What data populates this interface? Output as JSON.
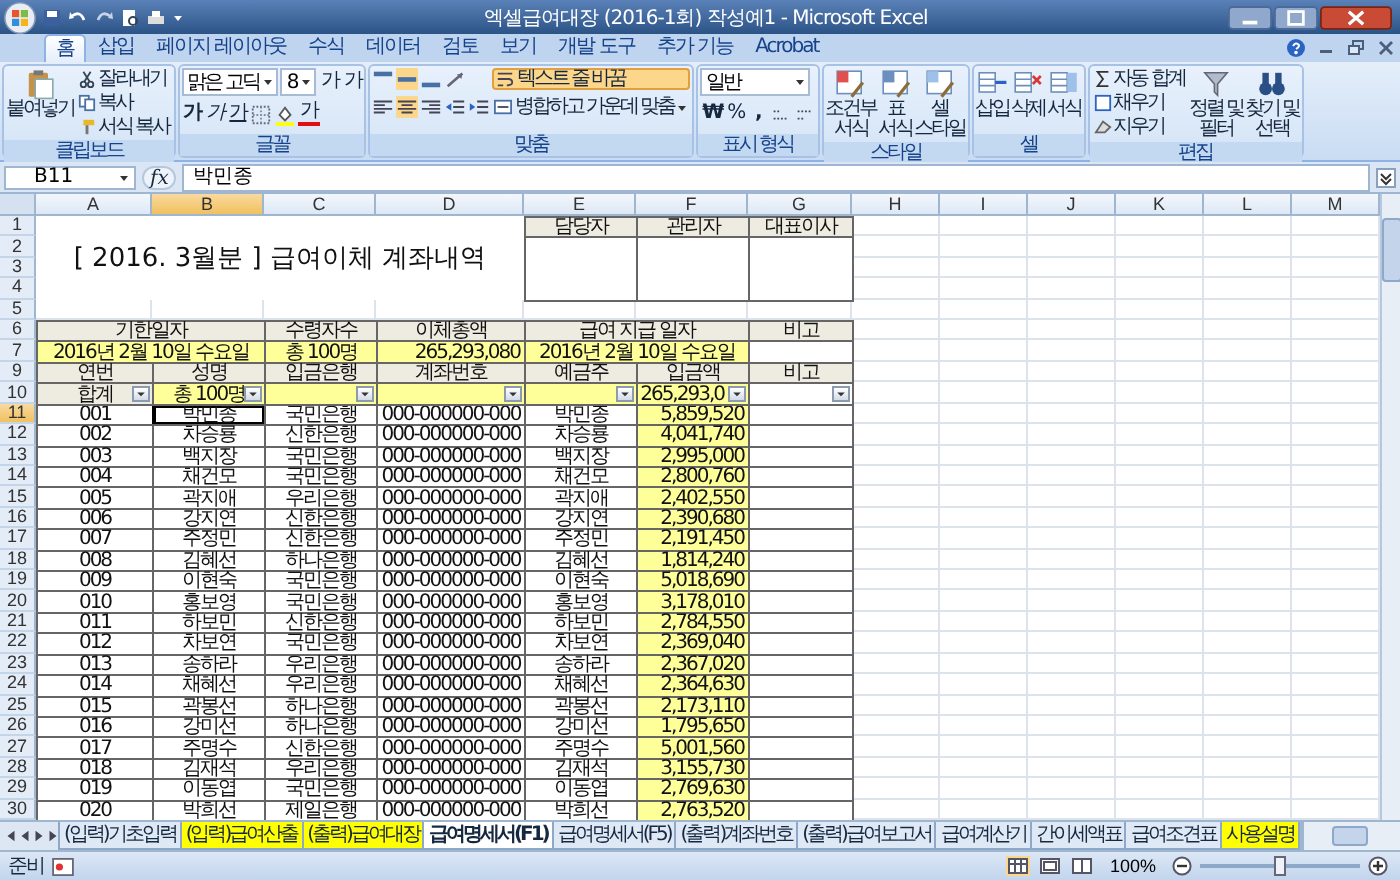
{
  "window": {
    "title": "엑셀급여대장 (2016-1회) 작성예1 - Microsoft Excel"
  },
  "ribbon_tabs": [
    {
      "label": "홈",
      "selected": true
    },
    {
      "label": "삽입",
      "selected": false
    },
    {
      "label": "페이지 레이아웃",
      "selected": false
    },
    {
      "label": "수식",
      "selected": false
    },
    {
      "label": "데이터",
      "selected": false
    },
    {
      "label": "검토",
      "selected": false
    },
    {
      "label": "보기",
      "selected": false
    },
    {
      "label": "개발 도구",
      "selected": false
    },
    {
      "label": "추가 기능",
      "selected": false
    },
    {
      "label": "Acrobat",
      "selected": false
    }
  ],
  "ribbon": {
    "clipboard": {
      "paste": "붙여넣기",
      "cut": "잘라내기",
      "copy": "복사",
      "format_painter": "서식 복사",
      "label": "클립보드"
    },
    "font": {
      "name": "맑은 고딕",
      "size": "8",
      "grow": "가",
      "shrink": "가",
      "bold": "가",
      "italic": "가",
      "underline": "가",
      "font_color": "가",
      "label": "글꼴"
    },
    "alignment": {
      "vertical": [
        {
          "selected": false
        },
        {
          "selected": true
        },
        {
          "selected": false
        }
      ],
      "horizontal": [
        {
          "selected": false
        },
        {
          "selected": true
        },
        {
          "selected": false
        }
      ],
      "wrap_text": {
        "label": "텍스트 줄 바꿈",
        "on": true
      },
      "merge": "병합하고 가운데 맞춤",
      "label": "맞춤"
    },
    "number": {
      "format": "일반",
      "currency": "₩",
      "percent": "%",
      "comma": ",",
      "label": "표시 형식"
    },
    "styles": {
      "buttons": [
        {
          "line1": "조건부",
          "line2": "서식"
        },
        {
          "line1": "표",
          "line2": "서식"
        },
        {
          "line1": "셀",
          "line2": "스타일"
        }
      ],
      "label": "스타일"
    },
    "cells": {
      "buttons": [
        "삽입",
        "삭제",
        "서식"
      ],
      "label": "셀"
    },
    "editing": {
      "small": [
        "자동 합계",
        "채우기",
        "지우기"
      ],
      "big": [
        {
          "line1": "정렬 및",
          "line2": "필터"
        },
        {
          "line1": "찾기 및",
          "line2": "선택"
        }
      ],
      "label": "편집"
    }
  },
  "formula_bar": {
    "cell_ref": "B11",
    "function_symbol": "fx",
    "value": "박민종"
  },
  "sheet": {
    "columns": [
      {
        "label": "A",
        "selected": false
      },
      {
        "label": "B",
        "selected": true
      },
      {
        "label": "C",
        "selected": false
      },
      {
        "label": "D",
        "selected": false
      },
      {
        "label": "E",
        "selected": false
      },
      {
        "label": "F",
        "selected": false
      },
      {
        "label": "G",
        "selected": false
      },
      {
        "label": "H",
        "selected": false
      },
      {
        "label": "I",
        "selected": false
      },
      {
        "label": "J",
        "selected": false
      },
      {
        "label": "K",
        "selected": false
      },
      {
        "label": "L",
        "selected": false
      },
      {
        "label": "M",
        "selected": false
      }
    ],
    "rows": [
      {
        "label": "1",
        "selected": false
      },
      {
        "label": "2",
        "selected": false
      },
      {
        "label": "3",
        "selected": false
      },
      {
        "label": "4",
        "selected": false
      },
      {
        "label": "5",
        "selected": false
      },
      {
        "label": "6",
        "selected": false
      },
      {
        "label": "7",
        "selected": false
      },
      {
        "label": "9",
        "selected": false
      },
      {
        "label": "10",
        "selected": false
      },
      {
        "label": "11",
        "selected": true
      },
      {
        "label": "12",
        "selected": false
      },
      {
        "label": "13",
        "selected": false
      },
      {
        "label": "14",
        "selected": false
      },
      {
        "label": "15",
        "selected": false
      },
      {
        "label": "16",
        "selected": false
      },
      {
        "label": "17",
        "selected": false
      },
      {
        "label": "18",
        "selected": false
      },
      {
        "label": "19",
        "selected": false
      },
      {
        "label": "20",
        "selected": false
      },
      {
        "label": "21",
        "selected": false
      },
      {
        "label": "22",
        "selected": false
      },
      {
        "label": "23",
        "selected": false
      },
      {
        "label": "24",
        "selected": false
      },
      {
        "label": "25",
        "selected": false
      },
      {
        "label": "26",
        "selected": false
      },
      {
        "label": "27",
        "selected": false
      },
      {
        "label": "28",
        "selected": false
      },
      {
        "label": "29",
        "selected": false
      },
      {
        "label": "30",
        "selected": false
      }
    ],
    "title": "[ 2016. 3월분 ] 급여이체 계좌내역",
    "approval_headers": [
      "담당자",
      "관리자",
      "대표이사"
    ],
    "summary": {
      "headers": [
        "기한일자",
        "수령자수",
        "이체총액",
        "급여 지급 일자",
        "비고"
      ],
      "values": [
        "2016년 2월 10일 수요일",
        "총 100명",
        "265,293,080",
        "2016년 2월 10일 수요일"
      ]
    },
    "list_headers": [
      "연번",
      "성명",
      "입금은행",
      "계좌번호",
      "예금주",
      "입금액",
      "비고"
    ],
    "totals": {
      "count_label": "합계",
      "headcount": "총 100명",
      "amount": "265,293,0"
    },
    "employees": [
      {
        "no": "001",
        "name": "박민종",
        "bank": "국민은행",
        "account": "000-000000-000",
        "holder": "박민종",
        "amount": "5,859,520",
        "selected": true
      },
      {
        "no": "002",
        "name": "차승룡",
        "bank": "신한은행",
        "account": "000-000000-000",
        "holder": "차승룡",
        "amount": "4,041,740",
        "selected": false
      },
      {
        "no": "003",
        "name": "백지장",
        "bank": "국민은행",
        "account": "000-000000-000",
        "holder": "백지장",
        "amount": "2,995,000",
        "selected": false
      },
      {
        "no": "004",
        "name": "채건모",
        "bank": "국민은행",
        "account": "000-000000-000",
        "holder": "채건모",
        "amount": "2,800,760",
        "selected": false
      },
      {
        "no": "005",
        "name": "곽지애",
        "bank": "우리은행",
        "account": "000-000000-000",
        "holder": "곽지애",
        "amount": "2,402,550",
        "selected": false
      },
      {
        "no": "006",
        "name": "강지연",
        "bank": "신한은행",
        "account": "000-000000-000",
        "holder": "강지연",
        "amount": "2,390,680",
        "selected": false
      },
      {
        "no": "007",
        "name": "주정민",
        "bank": "신한은행",
        "account": "000-000000-000",
        "holder": "주정민",
        "amount": "2,191,450",
        "selected": false
      },
      {
        "no": "008",
        "name": "김혜선",
        "bank": "하나은행",
        "account": "000-000000-000",
        "holder": "김혜선",
        "amount": "1,814,240",
        "selected": false
      },
      {
        "no": "009",
        "name": "이현숙",
        "bank": "국민은행",
        "account": "000-000000-000",
        "holder": "이현숙",
        "amount": "5,018,690",
        "selected": false
      },
      {
        "no": "010",
        "name": "홍보영",
        "bank": "국민은행",
        "account": "000-000000-000",
        "holder": "홍보영",
        "amount": "3,178,010",
        "selected": false
      },
      {
        "no": "011",
        "name": "하보민",
        "bank": "신한은행",
        "account": "000-000000-000",
        "holder": "하보민",
        "amount": "2,784,550",
        "selected": false
      },
      {
        "no": "012",
        "name": "차보연",
        "bank": "국민은행",
        "account": "000-000000-000",
        "holder": "차보연",
        "amount": "2,369,040",
        "selected": false
      },
      {
        "no": "013",
        "name": "송하라",
        "bank": "우리은행",
        "account": "000-000000-000",
        "holder": "송하라",
        "amount": "2,367,020",
        "selected": false
      },
      {
        "no": "014",
        "name": "채혜선",
        "bank": "우리은행",
        "account": "000-000000-000",
        "holder": "채혜선",
        "amount": "2,364,630",
        "selected": false
      },
      {
        "no": "015",
        "name": "곽봉선",
        "bank": "하나은행",
        "account": "000-000000-000",
        "holder": "곽봉선",
        "amount": "2,173,110",
        "selected": false
      },
      {
        "no": "016",
        "name": "강미선",
        "bank": "하나은행",
        "account": "000-000000-000",
        "holder": "강미선",
        "amount": "1,795,650",
        "selected": false
      },
      {
        "no": "017",
        "name": "주명수",
        "bank": "신한은행",
        "account": "000-000000-000",
        "holder": "주명수",
        "amount": "5,001,560",
        "selected": false
      },
      {
        "no": "018",
        "name": "김재석",
        "bank": "우리은행",
        "account": "000-000000-000",
        "holder": "김재석",
        "amount": "3,155,730",
        "selected": false
      },
      {
        "no": "019",
        "name": "이동엽",
        "bank": "국민은행",
        "account": "000-000000-000",
        "holder": "이동엽",
        "amount": "2,769,630",
        "selected": false
      },
      {
        "no": "020",
        "name": "박희선",
        "bank": "제일은행",
        "account": "000-000000-000",
        "holder": "박희선",
        "amount": "2,763,520",
        "selected": false
      }
    ]
  },
  "sheet_tabs": [
    {
      "label": "(입력)기초입력",
      "selected": false
    },
    {
      "label": "(입력)급여산출",
      "selected": false,
      "color": "#ffff00"
    },
    {
      "label": "(출력)급여대장",
      "selected": false,
      "color": "#ffff00"
    },
    {
      "label": "급여명세서(F1)",
      "selected": true
    },
    {
      "label": "급여명세서(F5)",
      "selected": false
    },
    {
      "label": "(출력)계좌번호",
      "selected": false
    },
    {
      "label": "(출력)급여보고서",
      "selected": false
    },
    {
      "label": "급여계산기",
      "selected": false
    },
    {
      "label": "간이세액표",
      "selected": false
    },
    {
      "label": "급여조견표",
      "selected": false
    },
    {
      "label": "사용설명",
      "selected": false,
      "color": "#ffff00"
    }
  ],
  "status_bar": {
    "status": "준비",
    "views": [
      {
        "selected": true
      },
      {
        "selected": false
      },
      {
        "selected": false
      }
    ],
    "zoom": "100%",
    "zoom_slider": {
      "level": 0.5
    }
  }
}
